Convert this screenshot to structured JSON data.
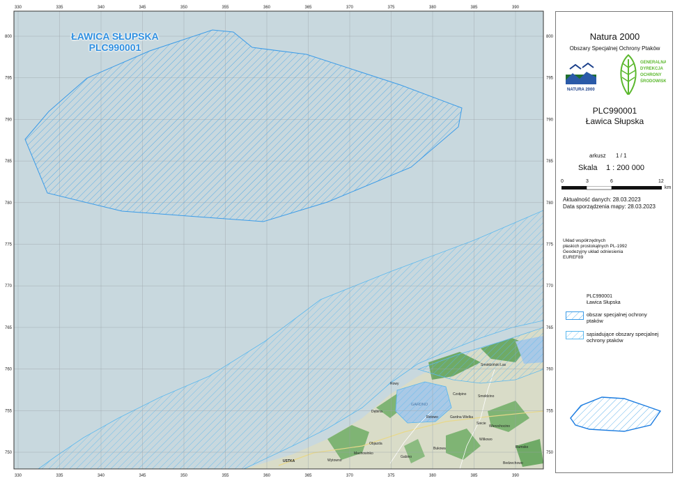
{
  "map": {
    "area_label": {
      "line1": "ŁAWICA SŁUPSKA",
      "line2": "PLC990001"
    },
    "x_ticks": [
      "330",
      "335",
      "340",
      "345",
      "350",
      "355",
      "360",
      "365",
      "370",
      "375",
      "380",
      "385",
      "390"
    ],
    "y_ticks": [
      "800",
      "795",
      "790",
      "785",
      "780",
      "775",
      "770",
      "765",
      "760",
      "755",
      "750"
    ],
    "place_names": [
      "Rowy",
      "Smołdziński Las",
      "Czołpino",
      "Smołdzino",
      "GARDNO",
      "Dębina",
      "Retowo",
      "Gardna Wielka",
      "Siecie",
      "Wierzchocino",
      "Objazda",
      "Wilkowo",
      "Machowinko",
      "Wytowno",
      "Bukowa",
      "Gabino",
      "Rumsko",
      "Bedzechowo",
      "USTKA"
    ],
    "colors": {
      "sea": "#c8d8de",
      "hatch": "#3aa0e8",
      "boundary": "#3a9be8",
      "land": "#d7dbc5",
      "forest": "#6faa66",
      "lake": "#a9c9e6"
    }
  },
  "panel": {
    "title": "Natura 2000",
    "subtitle": "Obszary Specjalnej Ochrony Ptaków",
    "logo_natura": "NATURA 2000",
    "logo_gdos": [
      "GENERALNA",
      "DYREKCJA",
      "OCHRONY",
      "ŚRODOWISKA"
    ],
    "code": "PLC990001",
    "name": "Ławica Słupska",
    "sheet_label": "arkusz",
    "sheet_value": "1 / 1",
    "scale_label": "Skala",
    "scale_value": "1 : 200 000",
    "scale_ticks": [
      "0",
      "3",
      "6",
      "12"
    ],
    "scale_unit": "km",
    "data_date": "Aktualność danych: 28.03.2023",
    "map_date": "Data sporządzenia mapy: 28.03.2023",
    "crs": [
      "Układ współrzędnych",
      "płaskich prostokątnych PL-1992",
      "Geodezyjny układ odniesienia",
      "EUREF89"
    ],
    "legend_code": "PLC990001",
    "legend_name": "Ławica Słupska",
    "legend_items": [
      {
        "label": [
          "obszar specjalnej ochrony",
          "ptaków"
        ]
      },
      {
        "label": [
          "sąsiadujące obszary specjalnej",
          "ochrony ptaków"
        ]
      }
    ]
  }
}
